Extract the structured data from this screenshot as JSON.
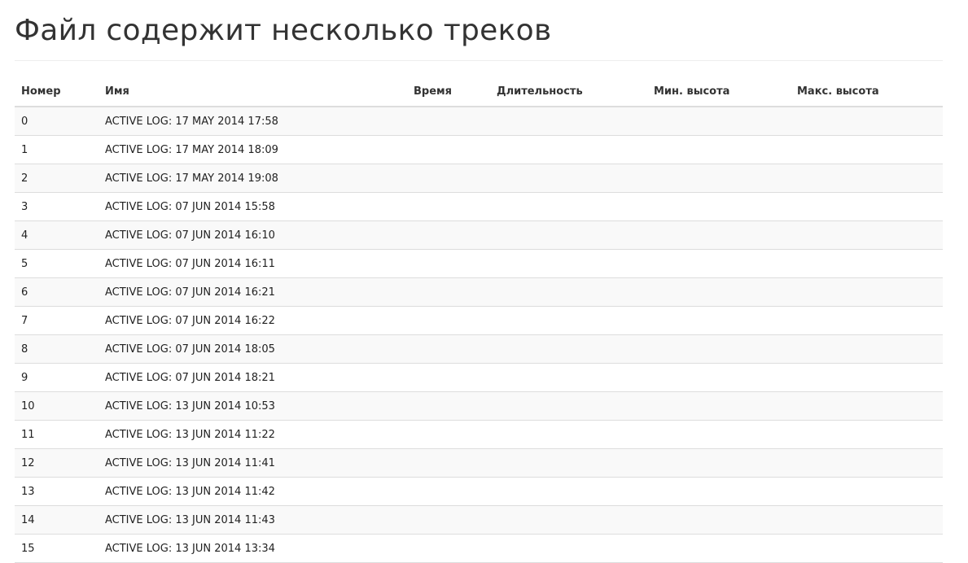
{
  "page": {
    "title": "Файл содержит несколько треков"
  },
  "table": {
    "headers": {
      "number": "Номер",
      "name": "Имя",
      "time": "Время",
      "duration": "Длительность",
      "min_altitude": "Мин. высота",
      "max_altitude": "Макс. высота"
    },
    "rows": [
      {
        "number": "0",
        "name": "ACTIVE LOG: 17 MAY 2014 17:58",
        "time": "",
        "duration": "",
        "min_altitude": "",
        "max_altitude": ""
      },
      {
        "number": "1",
        "name": "ACTIVE LOG: 17 MAY 2014 18:09",
        "time": "",
        "duration": "",
        "min_altitude": "",
        "max_altitude": ""
      },
      {
        "number": "2",
        "name": "ACTIVE LOG: 17 MAY 2014 19:08",
        "time": "",
        "duration": "",
        "min_altitude": "",
        "max_altitude": ""
      },
      {
        "number": "3",
        "name": "ACTIVE LOG: 07 JUN 2014 15:58",
        "time": "",
        "duration": "",
        "min_altitude": "",
        "max_altitude": ""
      },
      {
        "number": "4",
        "name": "ACTIVE LOG: 07 JUN 2014 16:10",
        "time": "",
        "duration": "",
        "min_altitude": "",
        "max_altitude": ""
      },
      {
        "number": "5",
        "name": "ACTIVE LOG: 07 JUN 2014 16:11",
        "time": "",
        "duration": "",
        "min_altitude": "",
        "max_altitude": ""
      },
      {
        "number": "6",
        "name": "ACTIVE LOG: 07 JUN 2014 16:21",
        "time": "",
        "duration": "",
        "min_altitude": "",
        "max_altitude": ""
      },
      {
        "number": "7",
        "name": "ACTIVE LOG: 07 JUN 2014 16:22",
        "time": "",
        "duration": "",
        "min_altitude": "",
        "max_altitude": ""
      },
      {
        "number": "8",
        "name": "ACTIVE LOG: 07 JUN 2014 18:05",
        "time": "",
        "duration": "",
        "min_altitude": "",
        "max_altitude": ""
      },
      {
        "number": "9",
        "name": "ACTIVE LOG: 07 JUN 2014 18:21",
        "time": "",
        "duration": "",
        "min_altitude": "",
        "max_altitude": ""
      },
      {
        "number": "10",
        "name": "ACTIVE LOG: 13 JUN 2014 10:53",
        "time": "",
        "duration": "",
        "min_altitude": "",
        "max_altitude": ""
      },
      {
        "number": "11",
        "name": "ACTIVE LOG: 13 JUN 2014 11:22",
        "time": "",
        "duration": "",
        "min_altitude": "",
        "max_altitude": ""
      },
      {
        "number": "12",
        "name": "ACTIVE LOG: 13 JUN 2014 11:41",
        "time": "",
        "duration": "",
        "min_altitude": "",
        "max_altitude": ""
      },
      {
        "number": "13",
        "name": "ACTIVE LOG: 13 JUN 2014 11:42",
        "time": "",
        "duration": "",
        "min_altitude": "",
        "max_altitude": ""
      },
      {
        "number": "14",
        "name": "ACTIVE LOG: 13 JUN 2014 11:43",
        "time": "",
        "duration": "",
        "min_altitude": "",
        "max_altitude": ""
      },
      {
        "number": "15",
        "name": "ACTIVE LOG: 13 JUN 2014 13:34",
        "time": "",
        "duration": "",
        "min_altitude": "",
        "max_altitude": ""
      }
    ]
  }
}
